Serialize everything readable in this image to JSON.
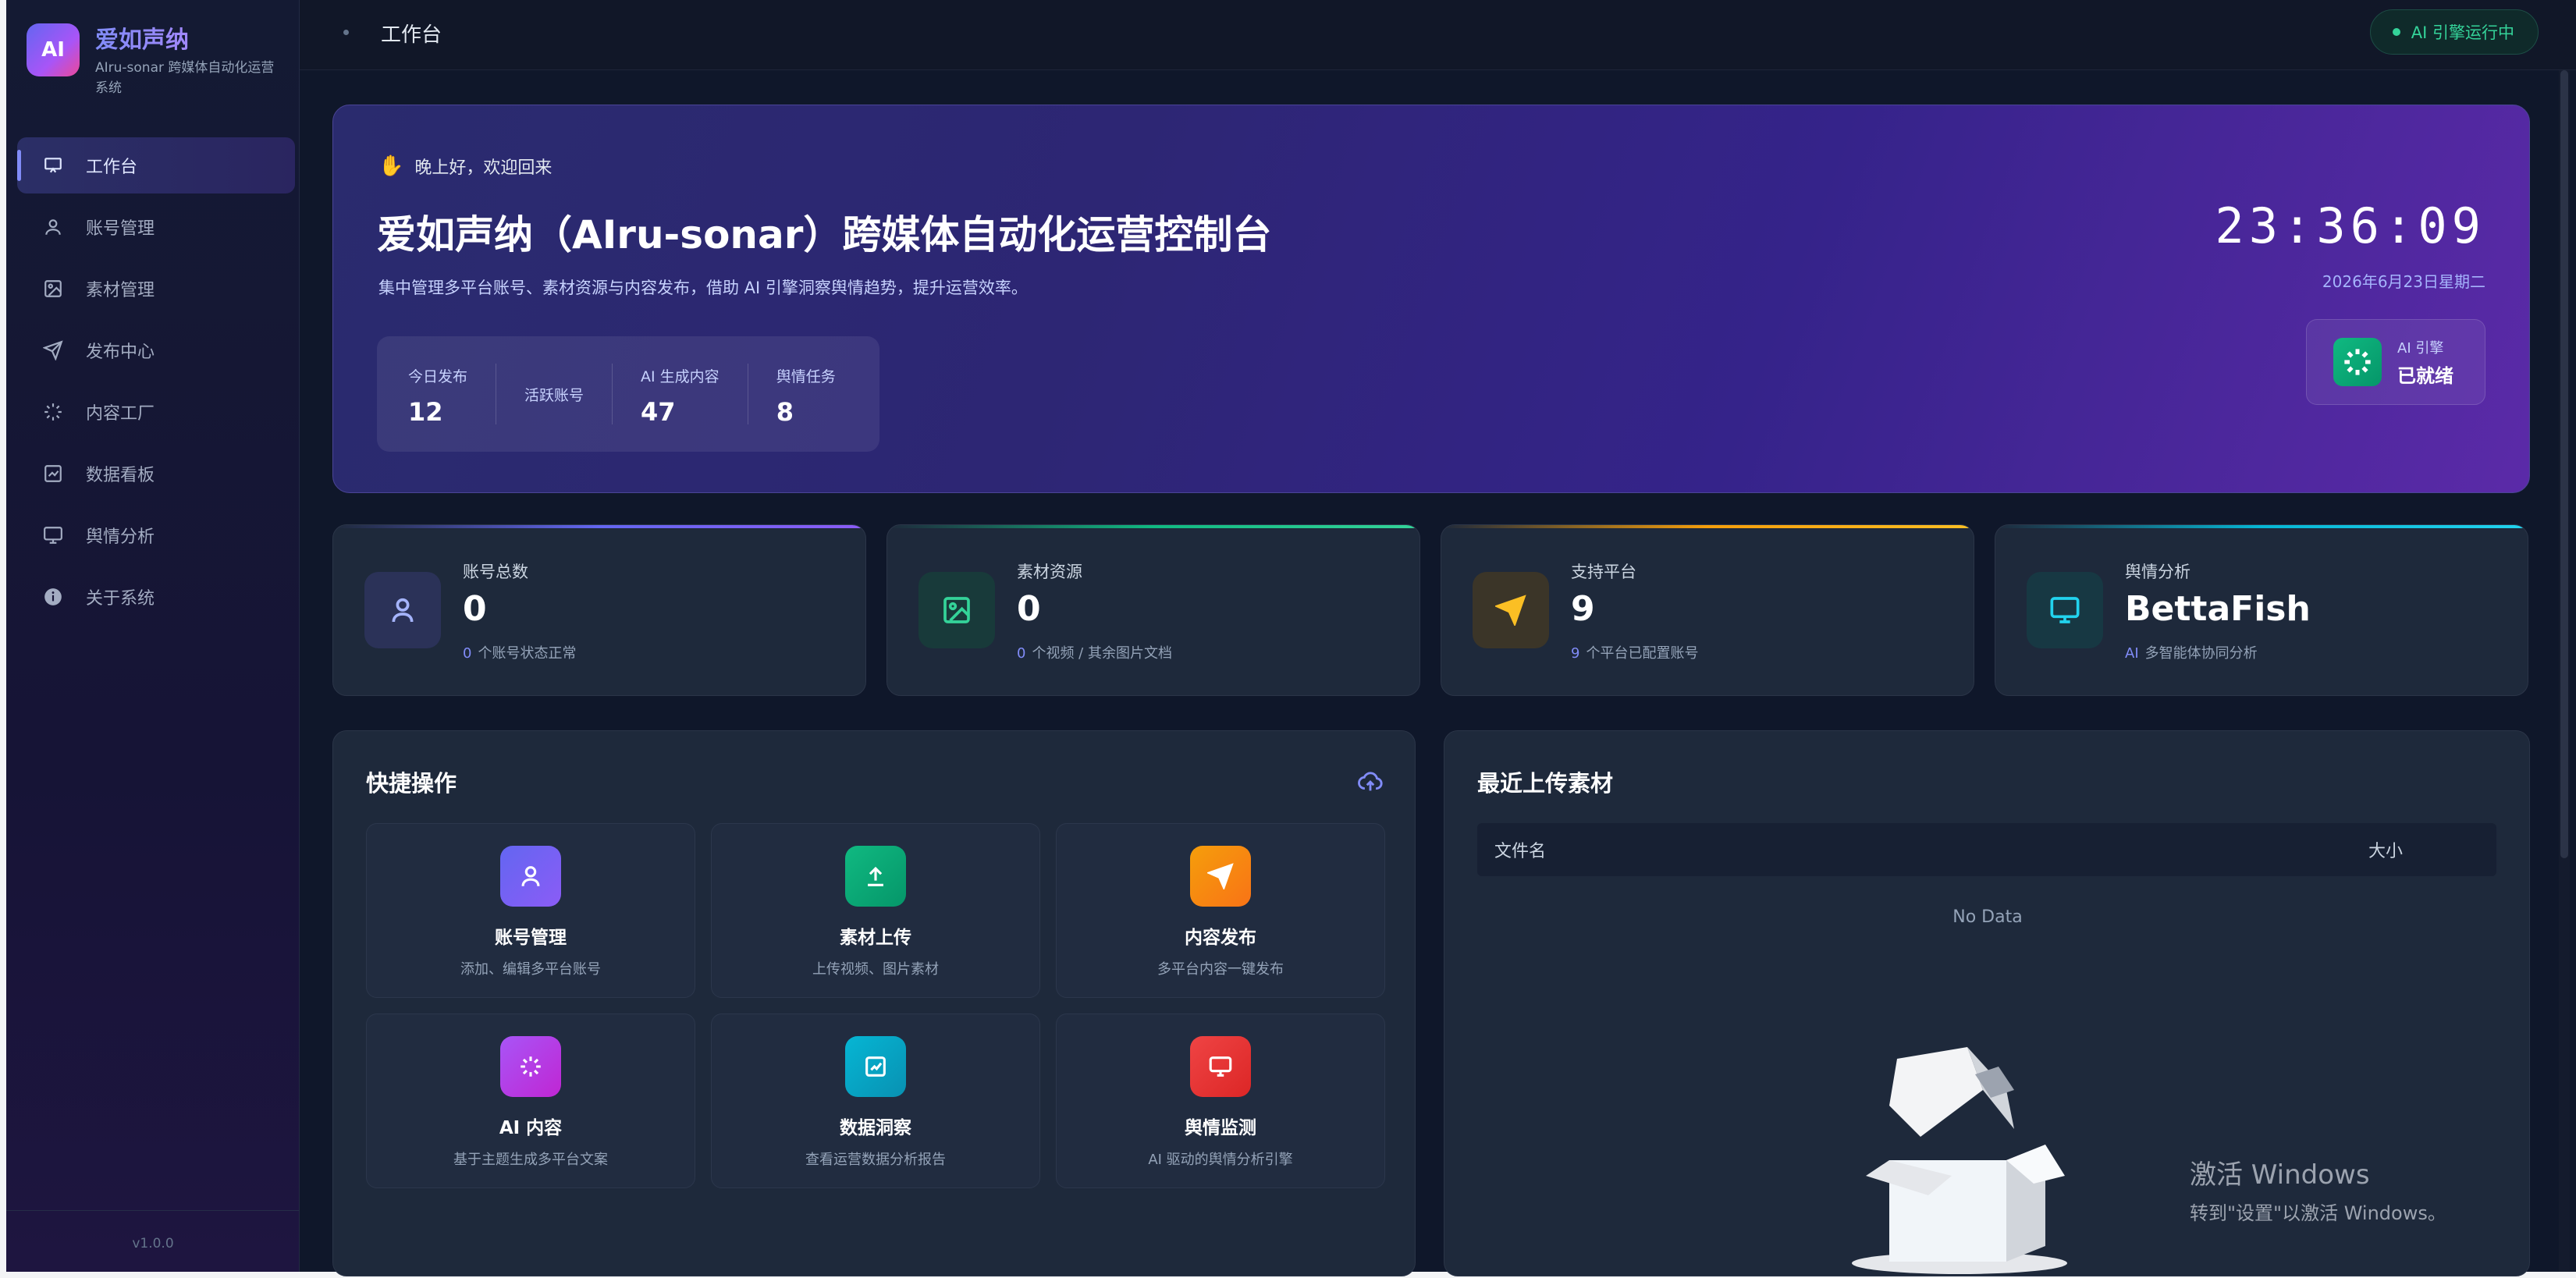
{
  "app": {
    "logo_text": "AI",
    "title": "爱如声纳",
    "subtitle": "AIru-sonar 跨媒体自动化运营系统",
    "version": "v1.0.0"
  },
  "sidebar": {
    "items": [
      {
        "label": "工作台",
        "icon": "workbench-icon",
        "active": true
      },
      {
        "label": "账号管理",
        "icon": "user-icon"
      },
      {
        "label": "素材管理",
        "icon": "image-icon"
      },
      {
        "label": "发布中心",
        "icon": "send-icon"
      },
      {
        "label": "内容工厂",
        "icon": "spinner-icon"
      },
      {
        "label": "数据看板",
        "icon": "chart-icon"
      },
      {
        "label": "舆情分析",
        "icon": "monitor-icon"
      },
      {
        "label": "关于系统",
        "icon": "info-icon"
      }
    ]
  },
  "topbar": {
    "breadcrumb": "工作台",
    "engine_status": "AI 引擎运行中"
  },
  "hero": {
    "greeting": "晚上好，欢迎回来",
    "title": "爱如声纳（AIru-sonar）跨媒体自动化运营控制台",
    "description": "集中管理多平台账号、素材资源与内容发布，借助 AI 引擎洞察舆情趋势，提升运营效率。",
    "stats": [
      {
        "label": "今日发布",
        "value": "12"
      },
      {
        "label": "活跃账号",
        "value": ""
      },
      {
        "label": "AI 生成内容",
        "value": "47"
      },
      {
        "label": "舆情任务",
        "value": "8"
      }
    ],
    "clock": "23:36:09",
    "date": "2026年6月23日星期二",
    "engine_label": "AI 引擎",
    "engine_state": "已就绪"
  },
  "metrics": [
    {
      "label": "账号总数",
      "value": "0",
      "note_hl": "0",
      "note": "个账号状态正常",
      "color": "#6366f1"
    },
    {
      "label": "素材资源",
      "value": "0",
      "note_hl": "0",
      "note": "个视频 / 其余图片文档",
      "color": "#10b981"
    },
    {
      "label": "支持平台",
      "value": "9",
      "note_hl": "9",
      "note": "个平台已配置账号",
      "color": "#f59e0b"
    },
    {
      "label": "舆情分析",
      "value": "BettaFish",
      "note_hl": "AI",
      "note": "多智能体协同分析",
      "color": "#06b6d4"
    }
  ],
  "quick_actions": {
    "title": "快捷操作",
    "items": [
      {
        "title": "账号管理",
        "sub": "添加、编辑多平台账号",
        "color": "#6366f1"
      },
      {
        "title": "素材上传",
        "sub": "上传视频、图片素材",
        "color": "#10b981"
      },
      {
        "title": "内容发布",
        "sub": "多平台内容一键发布",
        "color": "#f59e0b"
      },
      {
        "title": "AI 内容",
        "sub": "基于主题生成多平台文案",
        "color": "#a855f7"
      },
      {
        "title": "数据洞察",
        "sub": "查看运营数据分析报告",
        "color": "#06b6d4"
      },
      {
        "title": "舆情监测",
        "sub": "AI 驱动的舆情分析引擎",
        "color": "#ef4444"
      }
    ]
  },
  "recent_uploads": {
    "title": "最近上传素材",
    "columns": [
      "文件名",
      "大小"
    ],
    "empty_text": "No Data"
  },
  "watermark": {
    "line1": "激活 Windows",
    "line2": "转到\"设置\"以激活 Windows。"
  }
}
